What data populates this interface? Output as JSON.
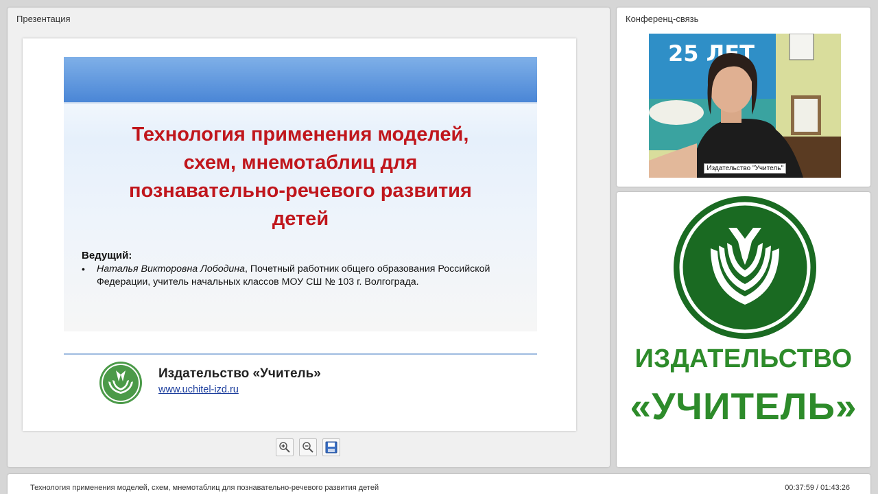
{
  "presentation": {
    "title": "Презентация",
    "slide": {
      "title": "Технология применения моделей,\nсхем, мнемотаблиц для\nпознавательно-речевого развития\nдетей",
      "host_heading": "Ведущий:",
      "bullet": "•",
      "host_name": "Наталья Викторовна Лободина",
      "host_desc": ", Почетный работник общего образования Российской Федерации, учитель начальных классов МОУ СШ № 103 г. Волгограда.",
      "publisher": "Издательство «Учитель»",
      "url": "www.uchitel-izd.ru"
    },
    "toolbar": {
      "zoom_in": "zoom-in-icon",
      "zoom_out": "zoom-out-icon",
      "save": "save-icon"
    }
  },
  "conference": {
    "title": "Конференц-связь",
    "video_label": "Издательство \"Учитель\"",
    "backdrop_text": "25 ЛЕТ"
  },
  "logo_panel": {
    "line1": "ИЗДАТЕЛЬСТВО",
    "line2": "«УЧИТЕЛЬ»",
    "brand_color": "#2d8b2a",
    "dark_green": "#1a6a22"
  },
  "status": {
    "title": "Технология применения моделей, схем, мнемотаблиц для познавательно-речевого развития детей",
    "time": "00:37:59 / 01:43:26"
  }
}
